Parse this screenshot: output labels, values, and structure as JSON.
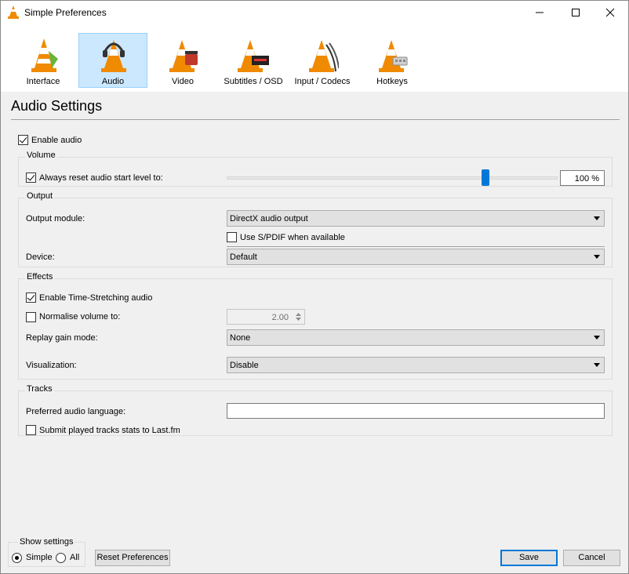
{
  "window": {
    "title": "Simple Preferences"
  },
  "toolbar": {
    "items": [
      {
        "label": "Interface",
        "icon": "interface-cone-icon"
      },
      {
        "label": "Audio",
        "icon": "audio-headphones-cone-icon"
      },
      {
        "label": "Video",
        "icon": "video-cone-icon"
      },
      {
        "label": "Subtitles / OSD",
        "icon": "subtitles-cone-icon"
      },
      {
        "label": "Input / Codecs",
        "icon": "input-codecs-cone-icon"
      },
      {
        "label": "Hotkeys",
        "icon": "hotkeys-cone-icon"
      }
    ]
  },
  "page": {
    "heading": "Audio Settings"
  },
  "enable_audio": {
    "label": "Enable audio",
    "checked": true
  },
  "volume": {
    "title": "Volume",
    "reset_label": "Always reset audio start level to:",
    "reset_checked": true,
    "level_value": "100 %",
    "level_percent": 0.79
  },
  "output": {
    "title": "Output",
    "module_label": "Output module:",
    "module_value": "DirectX audio output",
    "spdif_label": "Use S/PDIF when available",
    "spdif_checked": false,
    "device_label": "Device:",
    "device_value": "Default"
  },
  "effects": {
    "title": "Effects",
    "time_stretch_label": "Enable Time-Stretching audio",
    "time_stretch_checked": true,
    "normalise_label": "Normalise volume to:",
    "normalise_checked": false,
    "normalise_value": "2.00",
    "replay_gain_label": "Replay gain mode:",
    "replay_gain_value": "None",
    "visualization_label": "Visualization:",
    "visualization_value": "Disable"
  },
  "tracks": {
    "title": "Tracks",
    "preferred_language_label": "Preferred audio language:",
    "preferred_language_value": "",
    "lastfm_label": "Submit played tracks stats to Last.fm",
    "lastfm_checked": false
  },
  "show_settings": {
    "title": "Show settings",
    "simple_label": "Simple",
    "all_label": "All",
    "selected": "Simple"
  },
  "buttons": {
    "reset_label": "Reset Preferences",
    "save_label": "Save",
    "cancel_label": "Cancel"
  },
  "colors": {
    "accent": "#0078d7",
    "selected_bg": "#cce8ff",
    "cone_orange": "#f08a00"
  }
}
